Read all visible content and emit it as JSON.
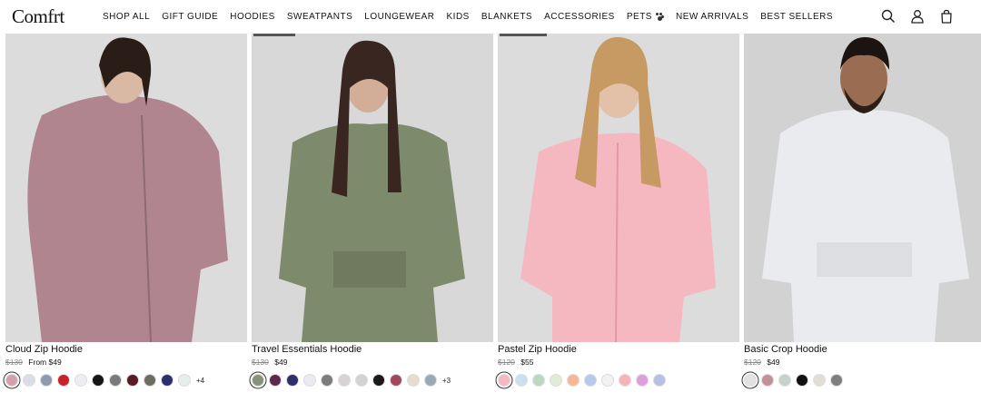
{
  "brand": {
    "logo": "Comfrt"
  },
  "nav": [
    "SHOP ALL",
    "GIFT GUIDE",
    "HOODIES",
    "SWEATPANTS",
    "LOUNGEWEAR",
    "KIDS",
    "BLANKETS",
    "ACCESSORIES",
    "PETS",
    "NEW ARRIVALS",
    "BEST SELLERS"
  ],
  "header_icons": [
    "search-icon",
    "account-icon",
    "cart-icon"
  ],
  "products": [
    {
      "name": "Cloud Zip Hoodie",
      "old_price": "$130",
      "price": "From $49",
      "garment_color": "#b08590",
      "swatches": [
        "#d4a0ae",
        "#dcdde8",
        "#8e9ab0",
        "#c8202c",
        "#eeeef2",
        "#151515",
        "#7a7a7a",
        "#5a1a26",
        "#6d6d62",
        "#2c2f6e",
        "#e6eeea"
      ],
      "more": "+4"
    },
    {
      "name": "Travel Essentials Hoodie",
      "old_price": "$130",
      "price": "$49",
      "garment_color": "#7e8a6c",
      "swatches": [
        "#8a917a",
        "#5e2a4a",
        "#2b2f6a",
        "#eceaf0",
        "#7c7c7c",
        "#d8d4d4",
        "#d3d3d3",
        "#1a1a1a",
        "#9e4a5c",
        "#e6dccc",
        "#9aa8b8"
      ],
      "more": "+3"
    },
    {
      "name": "Pastel Zip Hoodie",
      "old_price": "$120",
      "price": "$55",
      "garment_color": "#f6b8c0",
      "swatches": [
        "#f7b8c2",
        "#c9e0f0",
        "#bcd8c0",
        "#e0ecd6",
        "#f6b896",
        "#b4cbea",
        "#f2f2f2",
        "#f8b4b4",
        "#dca0dc",
        "#b8c0e2"
      ],
      "more": ""
    },
    {
      "name": "Basic Crop Hoodie",
      "old_price": "$120",
      "price": "$49",
      "garment_color": "#e9ebee",
      "swatches": [
        "#e2e2e2",
        "#c49098",
        "#c8d2cc",
        "#111111",
        "#e2ddd6",
        "#7f7f7f"
      ],
      "more": ""
    }
  ]
}
